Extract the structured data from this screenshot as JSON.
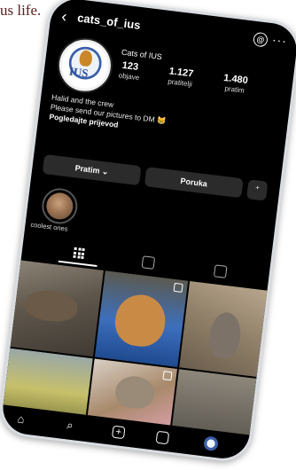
{
  "caption": {
    "text": "us life."
  },
  "profile": {
    "username": "cats_of_ius",
    "display_name": "Cats of IUS",
    "avatar_text": "IUS",
    "stats": [
      {
        "value": "123",
        "label": "objave"
      },
      {
        "value": "1.127",
        "label": "pratitelji"
      },
      {
        "value": "1.480",
        "label": "pratim"
      }
    ],
    "bio_lines": [
      "Halid and the crew",
      "Please send our pictures to DM 😸"
    ],
    "translate_link": "Pogledajte prijevod"
  },
  "actions": {
    "following_label": "Pratim ⌄",
    "message_label": "Poruka",
    "suggest_icon": "add-person-icon"
  },
  "highlights": [
    {
      "label": "coolest ones"
    }
  ],
  "tabs": [
    "grid-icon",
    "reels-icon",
    "tagged-icon"
  ],
  "bottom_nav": [
    "home-icon",
    "search-icon",
    "create-icon",
    "reels-icon",
    "profile-avatar"
  ],
  "colors": {
    "background": "#000000",
    "button": "#2b2b2b",
    "frame": "#d9dce0",
    "caption": "#5a1e1e"
  }
}
